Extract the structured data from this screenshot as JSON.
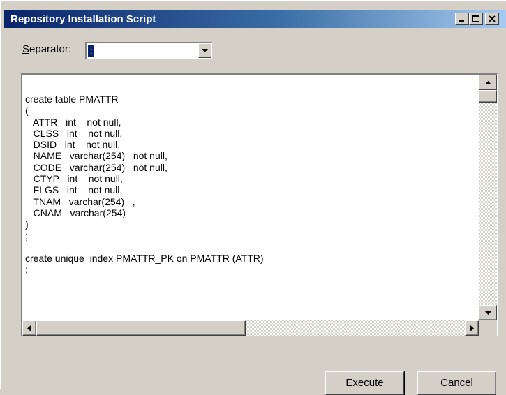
{
  "window": {
    "title": "Repository Installation Script",
    "controls": [
      "minimize-icon",
      "maximize-icon",
      "close-icon"
    ]
  },
  "separator": {
    "label_mnemonic": "S",
    "label_rest": "eparator:",
    "value": ";"
  },
  "script": {
    "text": "create table PMATTR\n(\n   ATTR   int    not null,\n   CLSS   int    not null,\n   DSID   int    not null,\n   NAME   varchar(254)   not null,\n   CODE   varchar(254)   not null,\n   CTYP   int    not null,\n   FLGS   int    not null,\n   TNAM   varchar(254)   ,\n   CNAM   varchar(254)\n)\n;\n\ncreate unique  index PMATTR_PK on PMATTR (ATTR)\n;"
  },
  "buttons": {
    "execute_pre": "E",
    "execute_mnemonic": "x",
    "execute_post": "ecute",
    "cancel": "Cancel"
  },
  "colors": {
    "titlebar_start": "#0a246a",
    "titlebar_end": "#a6caf0",
    "face": "#d4d0c8",
    "selection": "#0a246a"
  }
}
